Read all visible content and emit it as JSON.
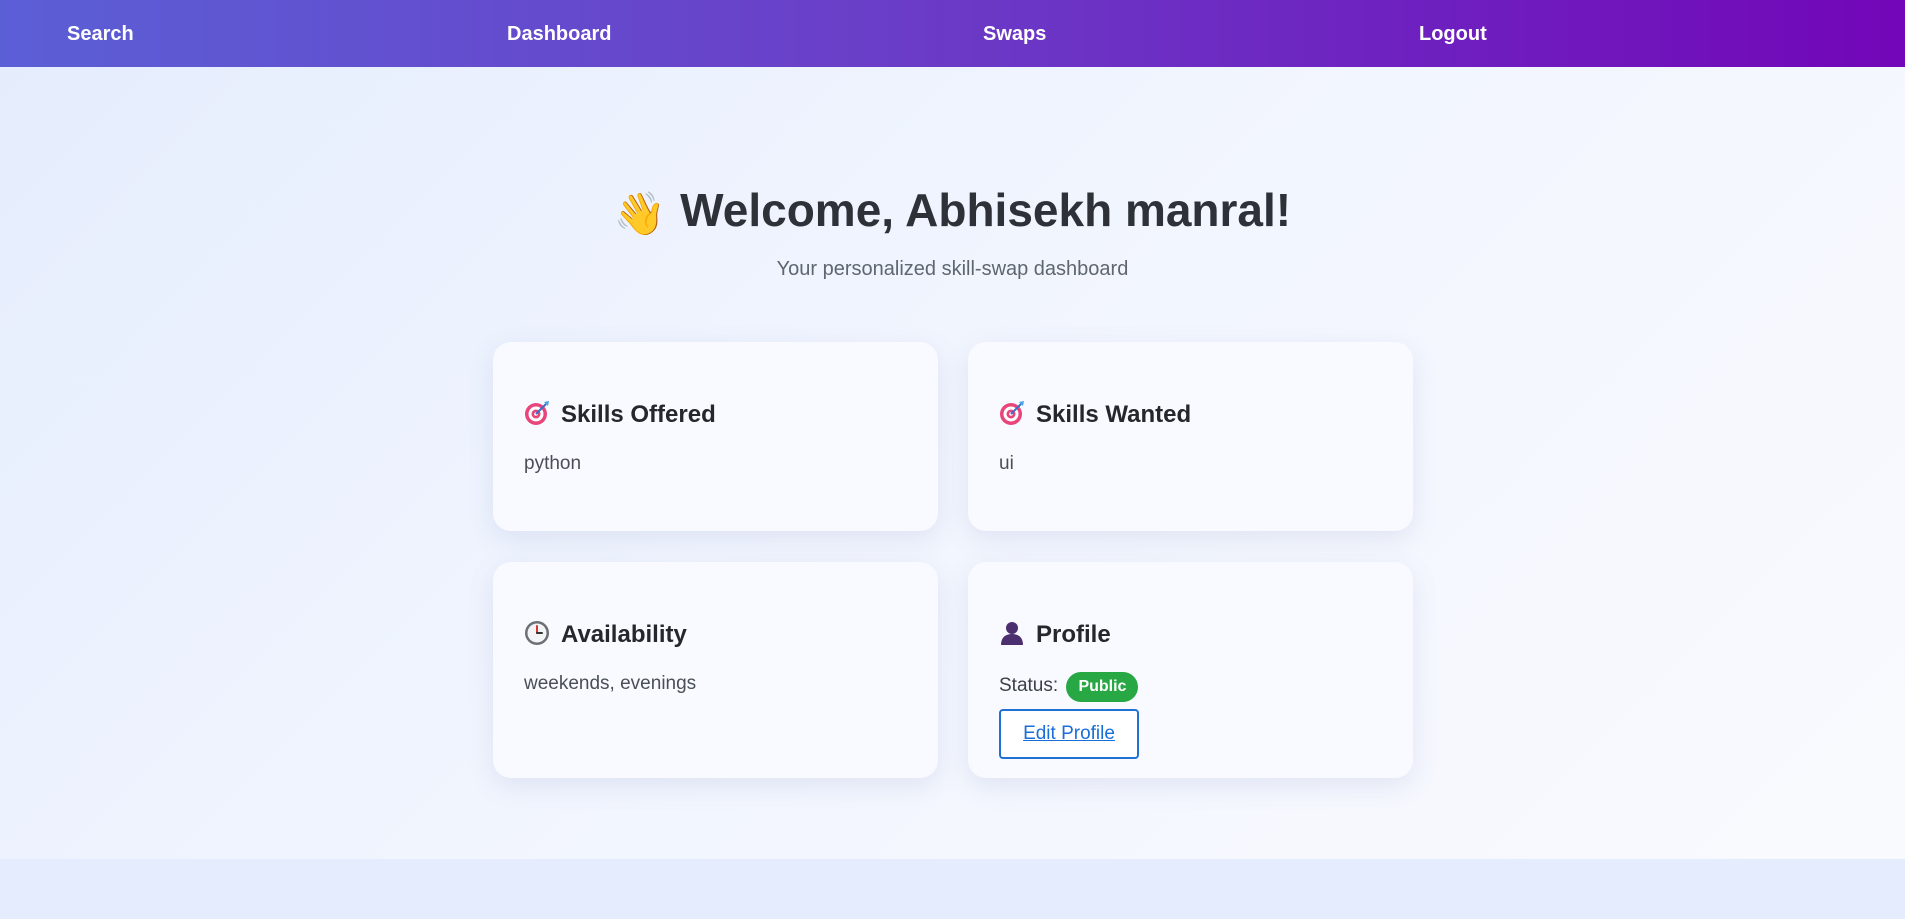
{
  "nav": {
    "items": [
      {
        "label": "Search"
      },
      {
        "label": "Dashboard"
      },
      {
        "label": "Swaps"
      },
      {
        "label": "Logout"
      }
    ]
  },
  "header": {
    "wave_icon": "waving-hand-icon",
    "welcome": "Welcome, Abhisekh manral!",
    "subtitle": "Your personalized skill-swap dashboard"
  },
  "cards": {
    "skills_offered": {
      "icon": "target-icon",
      "title": "Skills Offered",
      "value": "python"
    },
    "skills_wanted": {
      "icon": "target-icon",
      "title": "Skills Wanted",
      "value": "ui"
    },
    "availability": {
      "icon": "clock-icon",
      "title": "Availability",
      "value": "weekends, evenings"
    },
    "profile": {
      "icon": "user-icon",
      "title": "Profile",
      "status_label": "Status:",
      "status_value": "Public",
      "edit_label": "Edit Profile"
    }
  },
  "colors": {
    "nav_start": "#5b5fd6",
    "nav_end": "#7206b8",
    "badge": "#28a745",
    "link": "#1a6ed8"
  }
}
